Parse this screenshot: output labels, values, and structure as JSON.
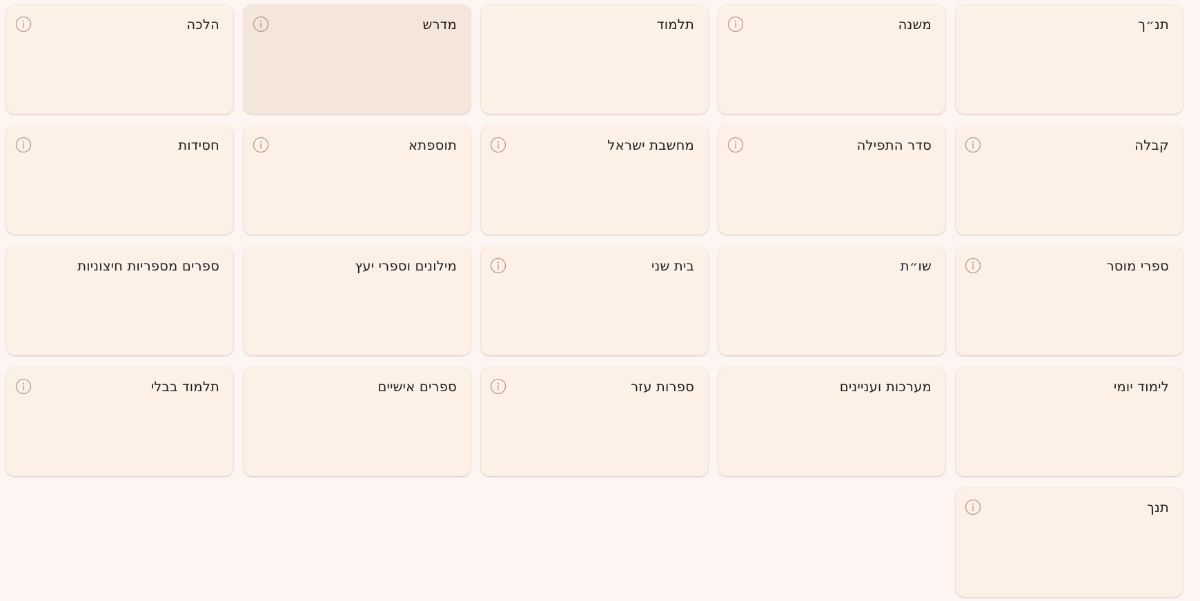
{
  "colors": {
    "page_background": "#fdf5f2",
    "card_background": "#fdf0e6",
    "card_hover_background": "#f4e6db",
    "title_text": "#1d1d1d",
    "info_icon": "#b09a8c"
  },
  "categories": [
    {
      "label": "תנ״ך",
      "icon": "",
      "hover": false
    },
    {
      "label": "משנה",
      "icon": "info-icon",
      "hover": false
    },
    {
      "label": "תלמוד",
      "icon": "",
      "hover": false
    },
    {
      "label": "מדרש",
      "icon": "info-icon",
      "hover": true
    },
    {
      "label": "הלכה",
      "icon": "info-icon",
      "hover": false
    },
    {
      "label": "קבלה",
      "icon": "info-icon",
      "hover": false
    },
    {
      "label": "סדר התפילה",
      "icon": "info-icon",
      "hover": false
    },
    {
      "label": "מחשבת ישראל",
      "icon": "info-icon",
      "hover": false
    },
    {
      "label": "תוספתא",
      "icon": "info-icon",
      "hover": false
    },
    {
      "label": "חסידות",
      "icon": "info-icon",
      "hover": false
    },
    {
      "label": "ספרי מוסר",
      "icon": "info-icon",
      "hover": false
    },
    {
      "label": "שו״ת",
      "icon": "",
      "hover": false
    },
    {
      "label": "בית שני",
      "icon": "info-icon",
      "hover": false
    },
    {
      "label": "מילונים וספרי יעץ",
      "icon": "",
      "hover": false
    },
    {
      "label": "ספרים מספריות חיצוניות",
      "icon": "",
      "hover": false
    },
    {
      "label": "לימוד יומי",
      "icon": "",
      "hover": false
    },
    {
      "label": "מערכות ועניינים",
      "icon": "",
      "hover": false
    },
    {
      "label": "ספרות עזר",
      "icon": "info-icon",
      "hover": false
    },
    {
      "label": "ספרים אישיים",
      "icon": "",
      "hover": false
    },
    {
      "label": "תלמוד בבלי",
      "icon": "info-icon",
      "hover": false
    },
    {
      "label": "תנך",
      "icon": "info-icon",
      "hover": false
    }
  ]
}
